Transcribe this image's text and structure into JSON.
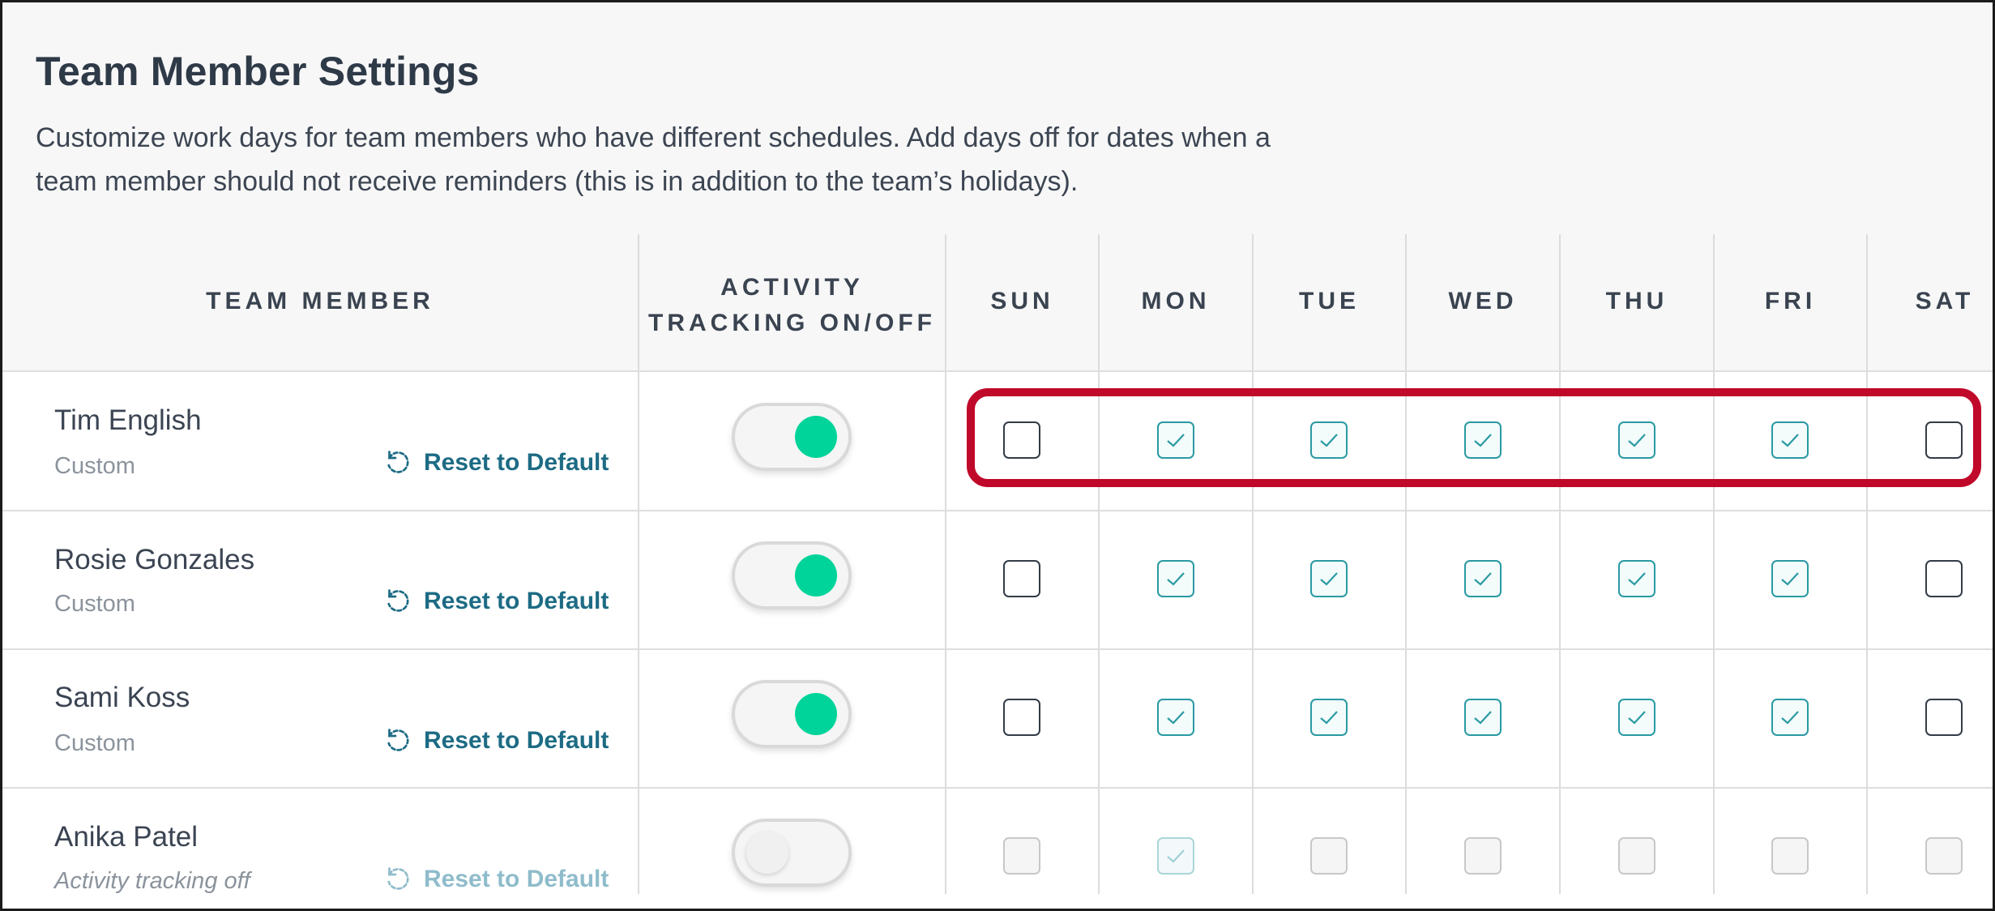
{
  "page": {
    "title": "Team Member Settings",
    "description_line1": "Customize work days for team members who have different schedules. Add days off for dates when a",
    "description_line2": "team member should not receive reminders (this is in addition to the team’s holidays)."
  },
  "columns": {
    "member": "TEAM MEMBER",
    "activity_line1": "ACTIVITY",
    "activity_line2": "TRACKING ON/OFF",
    "days": [
      "SUN",
      "MON",
      "TUE",
      "WED",
      "THU",
      "FRI",
      "SAT"
    ]
  },
  "members": [
    {
      "name": "Tim English",
      "status": "Custom",
      "reset_label": "Reset to Default",
      "tracking": "on",
      "days": [
        false,
        true,
        true,
        true,
        true,
        true,
        false
      ]
    },
    {
      "name": "Rosie Gonzales",
      "status": "Custom",
      "reset_label": "Reset to Default",
      "tracking": "on",
      "days": [
        false,
        true,
        true,
        true,
        true,
        true,
        false
      ]
    },
    {
      "name": "Sami Koss",
      "status": "Custom",
      "reset_label": "Reset to Default",
      "tracking": "on",
      "days": [
        false,
        true,
        true,
        true,
        true,
        true,
        false
      ]
    },
    {
      "name": "Anika Patel",
      "status": "Activity tracking off",
      "reset_label": "Reset to Default",
      "tracking": "off",
      "days": [
        false,
        true,
        false,
        false,
        false,
        false,
        false
      ]
    }
  ],
  "colors": {
    "accent_green": "#00d49a",
    "check_teal": "#2a9aa3",
    "link_blue": "#1d6b84",
    "highlight_red": "#c0082a"
  },
  "icons": {
    "reset": "reset-arrow-icon",
    "check": "checkmark-icon"
  }
}
